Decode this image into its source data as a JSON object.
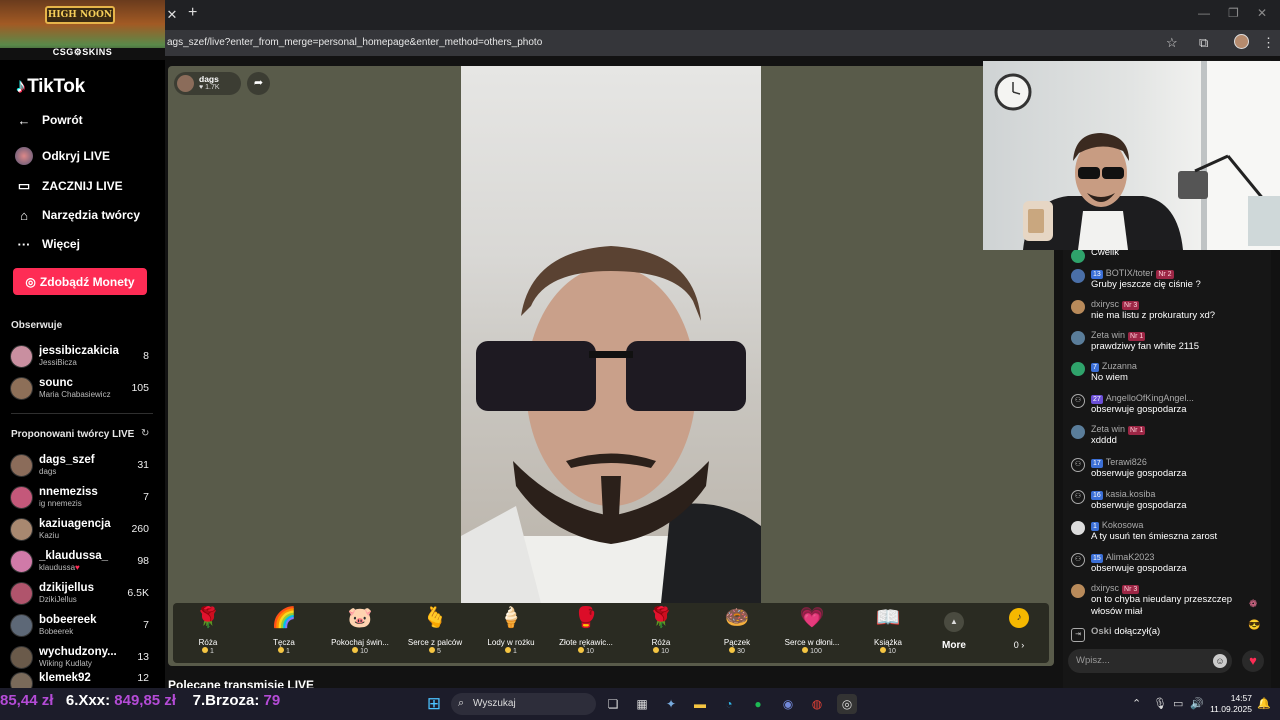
{
  "browser": {
    "url": "ags_szef/live?enter_from_merge=personal_homepage&enter_method=others_photo",
    "promo_sign": "HIGH NOON",
    "promo_brand": "CSG⚙SKINS"
  },
  "sidebar": {
    "logo": "TikTok",
    "nav": [
      {
        "label": "Powrót",
        "icon": "back-arrow-icon"
      },
      {
        "label": "Odkryj LIVE",
        "icon": "live-discover-icon"
      },
      {
        "label": "ZACZNIJ LIVE",
        "icon": "camera-icon"
      },
      {
        "label": "Narzędzia twórcy",
        "icon": "home-tools-icon"
      },
      {
        "label": "Więcej",
        "icon": "more-dots-icon"
      }
    ],
    "coins_button": "Zdobądź Monety",
    "following_title": "Obserwuje",
    "following": [
      {
        "name": "jessibiczakicia",
        "sub": "JessiBicza",
        "count": "8"
      },
      {
        "name": "sounc",
        "sub": "Maria Chabasiewicz",
        "count": "105"
      }
    ],
    "suggested_title": "Proponowani twórcy LIVE",
    "suggested": [
      {
        "name": "dags_szef",
        "sub": "dags",
        "count": "31"
      },
      {
        "name": "nnemeziss",
        "sub": "ig nnemezis",
        "count": "7"
      },
      {
        "name": "kaziuagencja",
        "sub": "Kaziu",
        "count": "260"
      },
      {
        "name": "_klaudussa_",
        "sub": "klaudussa",
        "count": "98"
      },
      {
        "name": "dzikijellus",
        "sub": "DzikiJellus",
        "count": "6.5K"
      },
      {
        "name": "bobeereek",
        "sub": "Bobeerek",
        "count": "7"
      },
      {
        "name": "wychudzony...",
        "sub": "Wiking Kudlaty",
        "count": "13"
      },
      {
        "name": "klemek92",
        "sub": "",
        "count": "12"
      }
    ]
  },
  "stream": {
    "host_name": "dags",
    "host_likes": "1.7K",
    "recommended_title": "Polecane transmisje LIVE"
  },
  "gifts": [
    {
      "name": "Róża",
      "price": "1",
      "icon": "🌹"
    },
    {
      "name": "Tęcza",
      "price": "1",
      "icon": "🌈"
    },
    {
      "name": "Pokochaj świn...",
      "price": "10",
      "icon": "🐷"
    },
    {
      "name": "Serce z palców",
      "price": "5",
      "icon": "🫰"
    },
    {
      "name": "Lody w rożku",
      "price": "1",
      "icon": "🍦"
    },
    {
      "name": "Złote rękawic...",
      "price": "10",
      "icon": "🥊"
    },
    {
      "name": "Róża",
      "price": "10",
      "icon": "🌹"
    },
    {
      "name": "Pączek",
      "price": "30",
      "icon": "🍩"
    },
    {
      "name": "Serce w dłoni...",
      "price": "100",
      "icon": "💗"
    },
    {
      "name": "Książka",
      "price": "10",
      "icon": "📖"
    }
  ],
  "gift_more": "More",
  "coin_balance": "0 ›",
  "chat": [
    {
      "user": "",
      "level": "",
      "nr": "",
      "text": "Cwelik",
      "avatar": "#2fa36b",
      "join": false
    },
    {
      "user": "BOTIX/toter",
      "level": "13",
      "nr": "Nr 2",
      "text": "Gruby jeszcze cię ciśnie ?",
      "avatar": "#4a6fa8",
      "join": false
    },
    {
      "user": "dxirysc",
      "level": "",
      "nr": "Nr 3",
      "text": "nie ma listu z prokuratury xd?",
      "avatar": "#b88a5a",
      "join": false
    },
    {
      "user": "Zeta win",
      "level": "",
      "nr": "Nr 1",
      "text": "prawdziwy fan white 2115",
      "avatar": "#5a7d9a",
      "join": false
    },
    {
      "user": "Zuzanna",
      "level": "7",
      "nr": "",
      "text": "No wiem",
      "avatar": "#2fa36b",
      "join": false
    },
    {
      "user": "AngelloOfKingAngel...",
      "level": "27",
      "nr": "",
      "text": "obserwuje gospodarza",
      "avatar": "",
      "join": true
    },
    {
      "user": "Zeta win",
      "level": "",
      "nr": "Nr 1",
      "text": "xdddd",
      "avatar": "#5a7d9a",
      "join": false
    },
    {
      "user": "Terawi826",
      "level": "17",
      "nr": "",
      "text": "obserwuje gospodarza",
      "avatar": "",
      "join": true
    },
    {
      "user": "kasia.kosiba",
      "level": "16",
      "nr": "",
      "text": "obserwuje gospodarza",
      "avatar": "",
      "join": true
    },
    {
      "user": "Kokosowa",
      "level": "1",
      "nr": "",
      "text": "A ty usuń ten śmieszna zarost",
      "avatar": "#dddddd",
      "join": false
    },
    {
      "user": "AlimaK2023",
      "level": "15",
      "nr": "",
      "text": "obserwuje gospodarza",
      "avatar": "",
      "join": true
    },
    {
      "user": "dxirysc",
      "level": "",
      "nr": "Nr 3",
      "text": "on to chyba nieudany przeszczep włosów miał",
      "avatar": "#b88a5a",
      "join": false
    }
  ],
  "joined": {
    "user": "Oski",
    "text": "dołączył(a)"
  },
  "chat_placeholder": "Wpisz...",
  "taskbar": {
    "ticker_a": "85,44 zł",
    "ticker_b": "6.Xxx:",
    "ticker_b_val": "849,85 zł",
    "ticker_c": "7.Brzoza:",
    "ticker_c_val": "79",
    "search": "Wyszukaj",
    "time": "14:57",
    "date": "11.09.2025"
  }
}
